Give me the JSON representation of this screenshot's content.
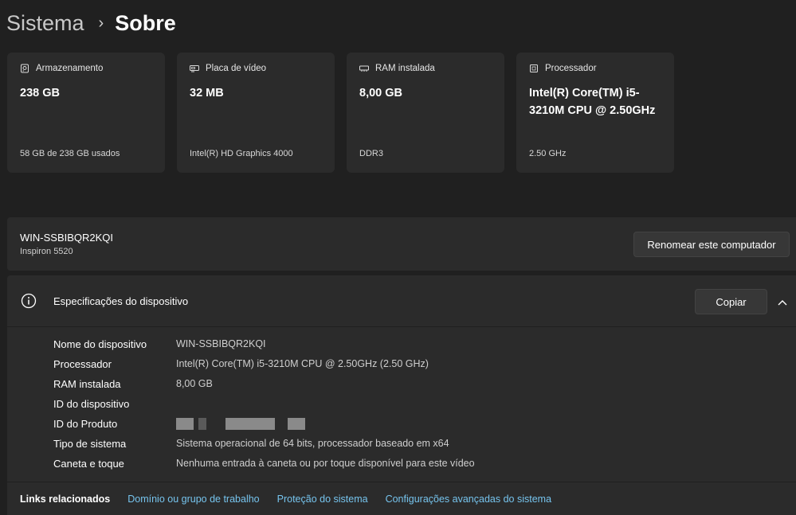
{
  "breadcrumb": {
    "parent": "Sistema",
    "separator": "›",
    "current": "Sobre"
  },
  "cards": [
    {
      "icon": "storage-icon",
      "title": "Armazenamento",
      "value": "238 GB",
      "sub": "58 GB de 238 GB usados"
    },
    {
      "icon": "graphics-card-icon",
      "title": "Placa de vídeo",
      "value": "32 MB",
      "sub": "Intel(R) HD Graphics 4000"
    },
    {
      "icon": "ram-icon",
      "title": "RAM instalada",
      "value": "8,00 GB",
      "sub": "DDR3"
    },
    {
      "icon": "processor-icon",
      "title": "Processador",
      "value": "Intel(R) Core(TM) i5-3210M CPU @ 2.50GHz",
      "sub": "2.50 GHz"
    }
  ],
  "device": {
    "name": "WIN-SSBIBQR2KQI",
    "model": "Inspiron 5520",
    "rename_label": "Renomear este computador"
  },
  "specs": {
    "title": "Especificações do dispositivo",
    "copy_label": "Copiar",
    "rows": [
      {
        "label": "Nome do dispositivo",
        "value": "WIN-SSBIBQR2KQI"
      },
      {
        "label": "Processador",
        "value": "Intel(R) Core(TM) i5-3210M CPU @ 2.50GHz (2.50 GHz)"
      },
      {
        "label": "RAM instalada",
        "value": "8,00 GB"
      },
      {
        "label": "ID do dispositivo",
        "value": ""
      },
      {
        "label": "ID do Produto",
        "value": ""
      },
      {
        "label": "Tipo de sistema",
        "value": "Sistema operacional de 64 bits, processador baseado em x64"
      },
      {
        "label": "Caneta e toque",
        "value": "Nenhuma entrada à caneta ou por toque disponível para este vídeo"
      }
    ]
  },
  "links": {
    "label": "Links relacionados",
    "items": [
      "Domínio ou grupo de trabalho",
      "Proteção do sistema",
      "Configurações avançadas do sistema"
    ]
  },
  "colors": {
    "background": "#202020",
    "card": "#2b2b2b",
    "link": "#76c4ee"
  }
}
